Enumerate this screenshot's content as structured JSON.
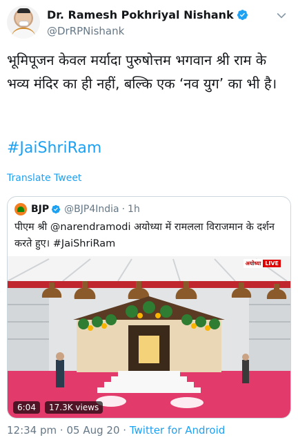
{
  "author": {
    "display_name": "Dr. Ramesh Pokhriyal Nishank",
    "handle": "@DrRPNishank",
    "verified": true,
    "avatar_icon": "profile-avatar"
  },
  "tweet": {
    "text": "भूमिपूजन केवल मर्यादा पुरुषोत्तम भगवान श्री राम के भव्य मंदिर का ही नहीं, बल्कि एक ‘नव युग’ का भी है।",
    "hashtag": "#JaiShriRam",
    "translate_label": "Translate Tweet"
  },
  "quoted_tweet": {
    "display_name": "BJP",
    "handle": "@BJP4India",
    "separator": "·",
    "time": "1h",
    "text": "पीएम श्री @narendramodi अयोध्या में रामलला विराजमान के दर्शन करते हुए। #JaiShriRam",
    "video": {
      "duration": "6:04",
      "views": "17.3K views",
      "channel_badge": "अयोध्या",
      "live_badge": "LIVE"
    }
  },
  "meta": {
    "time": "12:34 pm",
    "dot1": "·",
    "date": "05 Aug 20",
    "dot2": "·",
    "source": "Twitter for Android"
  },
  "colors": {
    "link_blue": "#1da1f2",
    "secondary_text": "#657786",
    "border": "#ccd6dd"
  }
}
